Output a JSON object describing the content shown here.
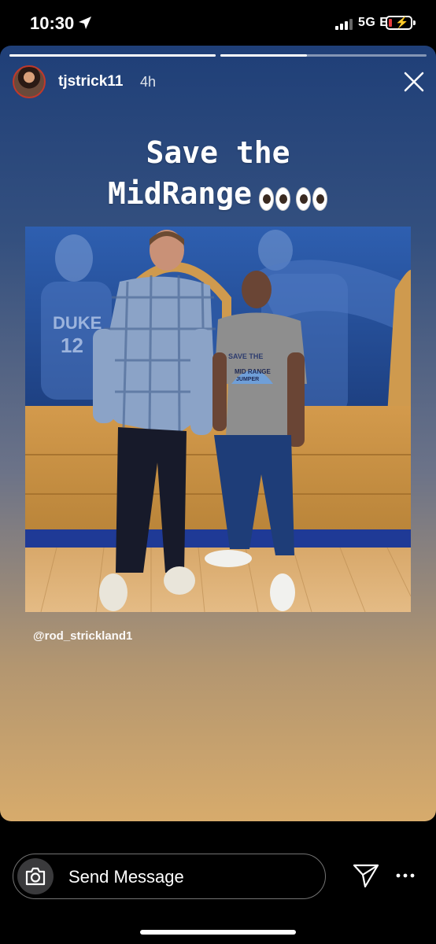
{
  "status_bar": {
    "time": "10:30",
    "network": "5G E",
    "icons": [
      "location-arrow-icon",
      "signal-icon",
      "battery-charging-icon"
    ]
  },
  "story": {
    "progress": [
      1.0,
      0.42
    ],
    "username": "tjstrick11",
    "age": "4h",
    "caption_line1": "Save the",
    "caption_line2": "MidRange",
    "caption_emoji": "eyes-emoji x2",
    "mention": "@rod_strickland1",
    "close_icon": "close-icon"
  },
  "photo": {
    "shirt_text_1": "SAVE THE",
    "shirt_text_2": "MID RANGE",
    "shirt_text_3": "JUMPER",
    "banner_text_1": "DUKE",
    "banner_text_2": "12"
  },
  "reply_bar": {
    "placeholder": "Send Message",
    "icons": [
      "camera-icon",
      "send-icon",
      "more-icon"
    ]
  },
  "colors": {
    "story_top": "#1f3f78",
    "story_bottom": "#d7ab6c",
    "battery_low": "#e5393b"
  }
}
